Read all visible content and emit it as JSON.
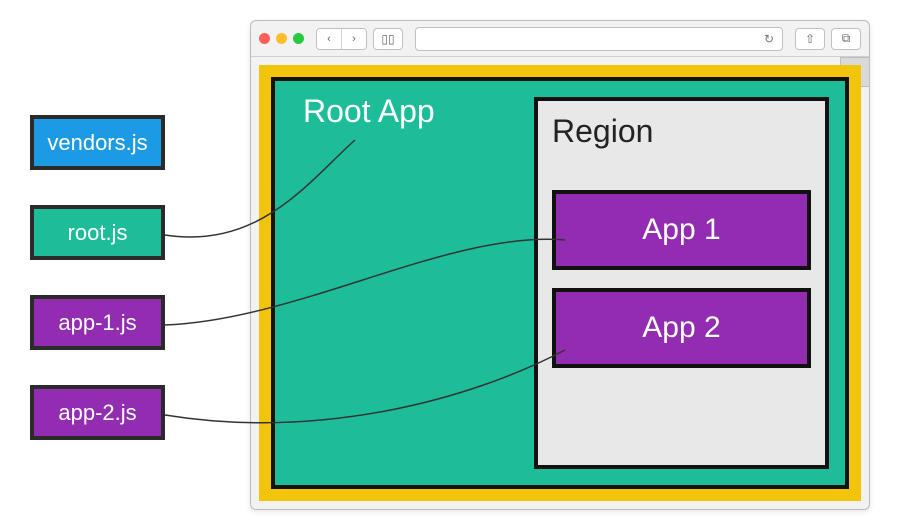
{
  "files": {
    "vendors": {
      "label": "vendors.js"
    },
    "root": {
      "label": "root.js"
    },
    "app1": {
      "label": "app-1.js"
    },
    "app2": {
      "label": "app-2.js"
    }
  },
  "browser": {
    "back": "‹",
    "forward": "›",
    "sidebar": "▯▯",
    "refresh": "↻",
    "share": "⇧",
    "tabs": "⧉",
    "new_tab": "+"
  },
  "diagram": {
    "root_label": "Root App",
    "region_label": "Region",
    "app1_label": "App 1",
    "app2_label": "App 2"
  }
}
